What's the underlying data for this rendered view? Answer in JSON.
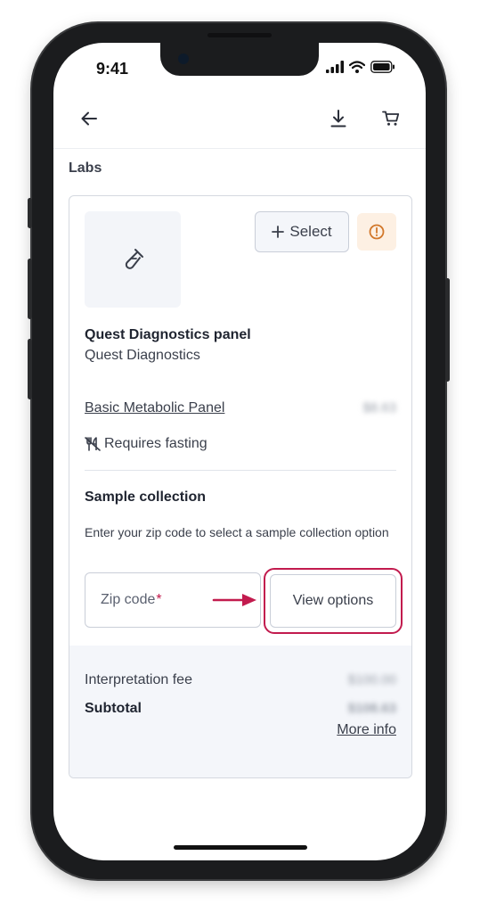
{
  "status_bar": {
    "time": "9:41"
  },
  "app_bar": {
    "back_icon": "arrow-left-icon",
    "download_icon": "download-icon",
    "cart_icon": "cart-icon"
  },
  "section": {
    "title": "Labs"
  },
  "lab_card": {
    "thumbnail_icon": "test-tube-icon",
    "select_label": "Select",
    "select_icon": "plus-icon",
    "alert_icon": "alert-circle-icon",
    "panel_title": "Quest Diagnostics panel",
    "panel_provider": "Quest Diagnostics",
    "test_name": "Basic Metabolic Panel",
    "test_price": "$8.63",
    "fasting_note": "Requires fasting",
    "sample_collection": {
      "title": "Sample collection",
      "description": "Enter your zip code to select a sample collection option",
      "zip_placeholder": "Zip code",
      "zip_required_mark": "*",
      "view_options_label": "View options"
    },
    "summary": {
      "interpretation_fee_label": "Interpretation fee",
      "interpretation_fee_value": "$100.00",
      "subtotal_label": "Subtotal",
      "subtotal_value": "$108.63",
      "more_info_label": "More info"
    }
  },
  "colors": {
    "accent": "#c21b4e",
    "alert_bg": "#fdf0e3",
    "alert_fg": "#d2772a",
    "muted_bg": "#f4f6fa"
  }
}
